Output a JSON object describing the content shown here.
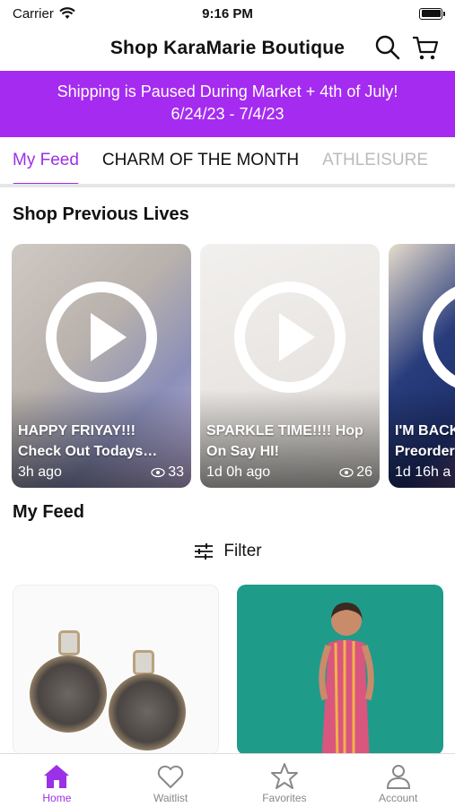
{
  "status": {
    "carrier": "Carrier",
    "time": "9:16 PM"
  },
  "header": {
    "title": "Shop KaraMarie Boutique",
    "search_icon": "search-icon",
    "cart_icon": "cart-icon"
  },
  "banner": {
    "line1": "Shipping is Paused During Market + 4th of July!",
    "line2": "6/24/23 - 7/4/23"
  },
  "colors": {
    "accent": "#9b30e8",
    "banner": "#a52bf0"
  },
  "tabs": [
    {
      "label": "My Feed"
    },
    {
      "label": "CHARM OF THE MONTH"
    },
    {
      "label": "ATHLEISURE"
    }
  ],
  "lives": {
    "title": "Shop Previous Lives",
    "items": [
      {
        "caption": "HAPPY FRIYAY!!!\nCheck Out Todays…",
        "ago": "3h ago",
        "views": "33"
      },
      {
        "caption": "SPARKLE TIME!!!! Hop\nOn Say HI!",
        "ago": "1d 0h ago",
        "views": "26"
      },
      {
        "caption": "I'M BACK\nPreorder",
        "ago": "1d 16h a",
        "views": ""
      }
    ]
  },
  "feed": {
    "title": "My Feed",
    "filter_label": "Filter"
  },
  "tabbar": [
    {
      "label": "Home",
      "icon": "home-icon"
    },
    {
      "label": "Waitlist",
      "icon": "heart-icon"
    },
    {
      "label": "Favorites",
      "icon": "star-icon"
    },
    {
      "label": "Account",
      "icon": "person-icon"
    }
  ]
}
